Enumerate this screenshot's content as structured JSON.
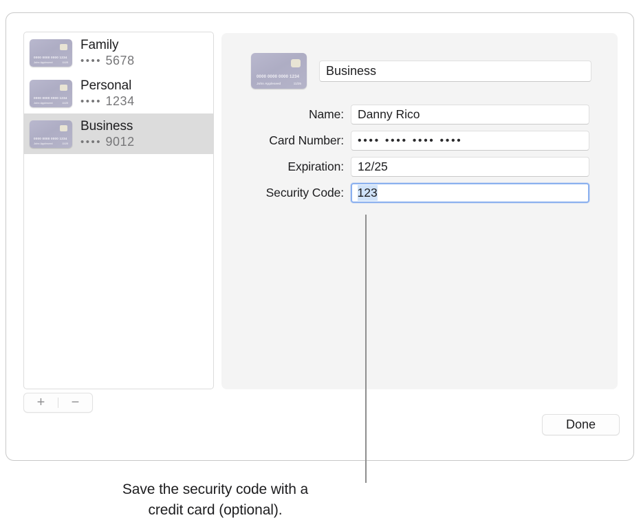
{
  "window": {
    "sidebar": {
      "cards": [
        {
          "title": "Family",
          "dots": "••••",
          "last4": "5678",
          "selected": false
        },
        {
          "title": "Personal",
          "dots": "••••",
          "last4": "1234",
          "selected": false
        },
        {
          "title": "Business",
          "dots": "••••",
          "last4": "9012",
          "selected": true
        }
      ],
      "add_label": "+",
      "remove_label": "−"
    },
    "card_art": {
      "number": "0000 0000 0000 1234",
      "name": "John Appleseed",
      "expiry": "11/25"
    },
    "detail": {
      "title_value": "Business",
      "fields": [
        {
          "label": "Name:",
          "value": "Danny Rico",
          "focused": false,
          "masked": false,
          "selected_text": ""
        },
        {
          "label": "Card Number:",
          "value": "•••• •••• •••• ••••",
          "focused": false,
          "masked": true,
          "selected_text": ""
        },
        {
          "label": "Expiration:",
          "value": "12/25",
          "focused": false,
          "masked": false,
          "selected_text": ""
        },
        {
          "label": "Security Code:",
          "value": "123",
          "focused": true,
          "masked": false,
          "selected_text": "123"
        }
      ]
    },
    "done_label": "Done"
  },
  "caption": {
    "line1": "Save the security code with a",
    "line2": "credit card (optional)."
  },
  "colors": {
    "selection_row": "#dcdcdc",
    "focus_ring": "#8ab0ef",
    "text_selection": "#cfe2f9",
    "panel_bg": "#f4f4f4",
    "card_art": "#b4b3c8"
  }
}
